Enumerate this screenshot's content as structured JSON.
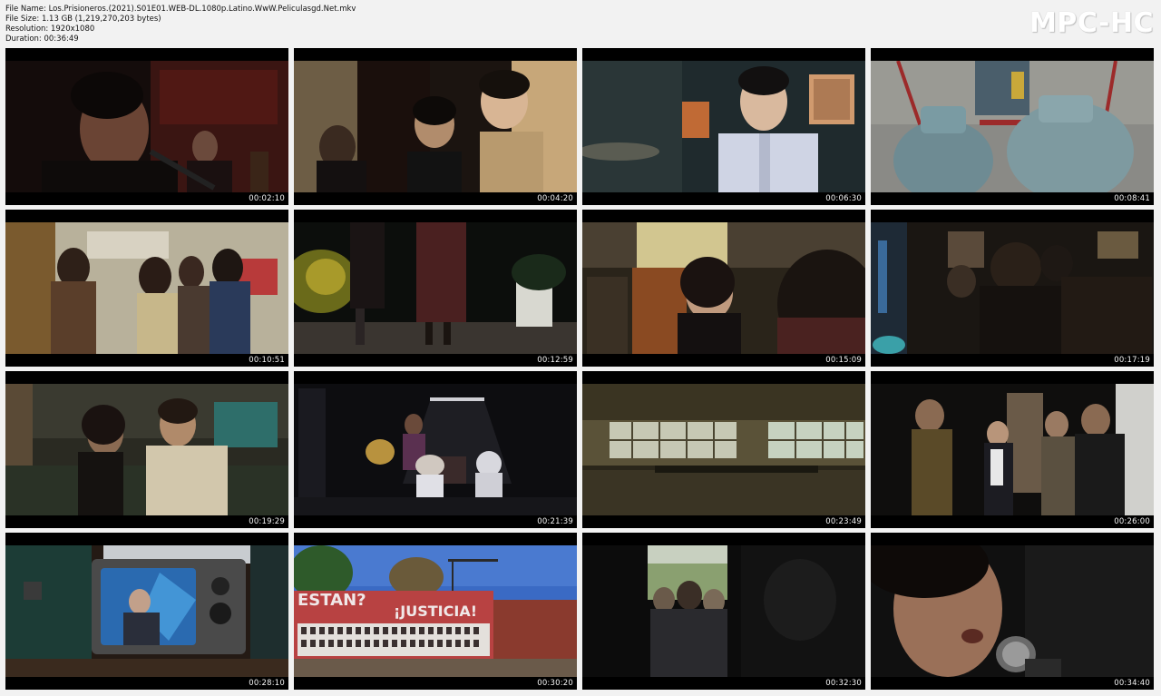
{
  "file_info": {
    "name": "File Name: Los.Prisioneros.(2021).S01E01.WEB-DL.1080p.Latino.WwW.Peliculasgd.Net.mkv",
    "size": "File Size: 1.13 GB (1,219,270,203 bytes)",
    "resolution": "Resolution: 1920x1080",
    "duration": "Duration: 00:36:49"
  },
  "brand": "MPC-HC",
  "thumbnails": [
    {
      "timestamp": "00:02:10",
      "scene": "singer-at-microphone"
    },
    {
      "timestamp": "00:04:20",
      "scene": "three-young-men"
    },
    {
      "timestamp": "00:06:30",
      "scene": "smiling-man-studio"
    },
    {
      "timestamp": "00:08:41",
      "scene": "gas-cylinders"
    },
    {
      "timestamp": "00:10:51",
      "scene": "kitchen-party"
    },
    {
      "timestamp": "00:12:59",
      "scene": "night-street-walk"
    },
    {
      "timestamp": "00:15:09",
      "scene": "woman-in-room"
    },
    {
      "timestamp": "00:17:19",
      "scene": "crowded-party"
    },
    {
      "timestamp": "00:19:29",
      "scene": "couple-on-sofa"
    },
    {
      "timestamp": "00:21:39",
      "scene": "band-rehearsal"
    },
    {
      "timestamp": "00:23:49",
      "scene": "factory-windows"
    },
    {
      "timestamp": "00:26:00",
      "scene": "band-in-dark-room"
    },
    {
      "timestamp": "00:28:10",
      "scene": "retro-television"
    },
    {
      "timestamp": "00:30:20",
      "scene": "mural-wall"
    },
    {
      "timestamp": "00:32:30",
      "scene": "crowd-at-door"
    },
    {
      "timestamp": "00:34:40",
      "scene": "singer-close-up"
    }
  ],
  "mural": {
    "left_text": "ESTAN?",
    "right_text": "¡JUSTICIA!"
  },
  "colors": {
    "page_background": "#f2f2f2",
    "tile_background": "#000000",
    "timestamp_text": "#f4f4f4"
  }
}
